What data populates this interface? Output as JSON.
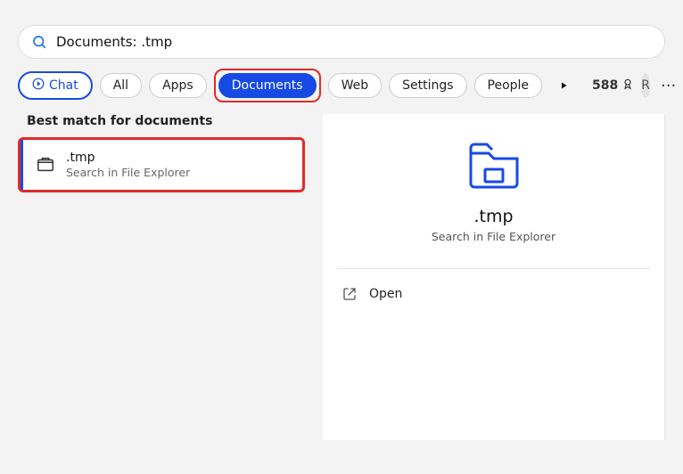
{
  "search": {
    "value": "Documents: .tmp"
  },
  "filters": {
    "chat": "Chat",
    "items": [
      "All",
      "Apps",
      "Documents",
      "Web",
      "Settings",
      "People"
    ],
    "activeIndex": 2
  },
  "header": {
    "points": "588",
    "avatar_initial": "R"
  },
  "results": {
    "heading": "Best match for documents",
    "item": {
      "title": ".tmp",
      "subtitle": "Search in File Explorer"
    }
  },
  "preview": {
    "title": ".tmp",
    "subtitle": "Search in File Explorer",
    "actions": {
      "open": "Open"
    }
  }
}
